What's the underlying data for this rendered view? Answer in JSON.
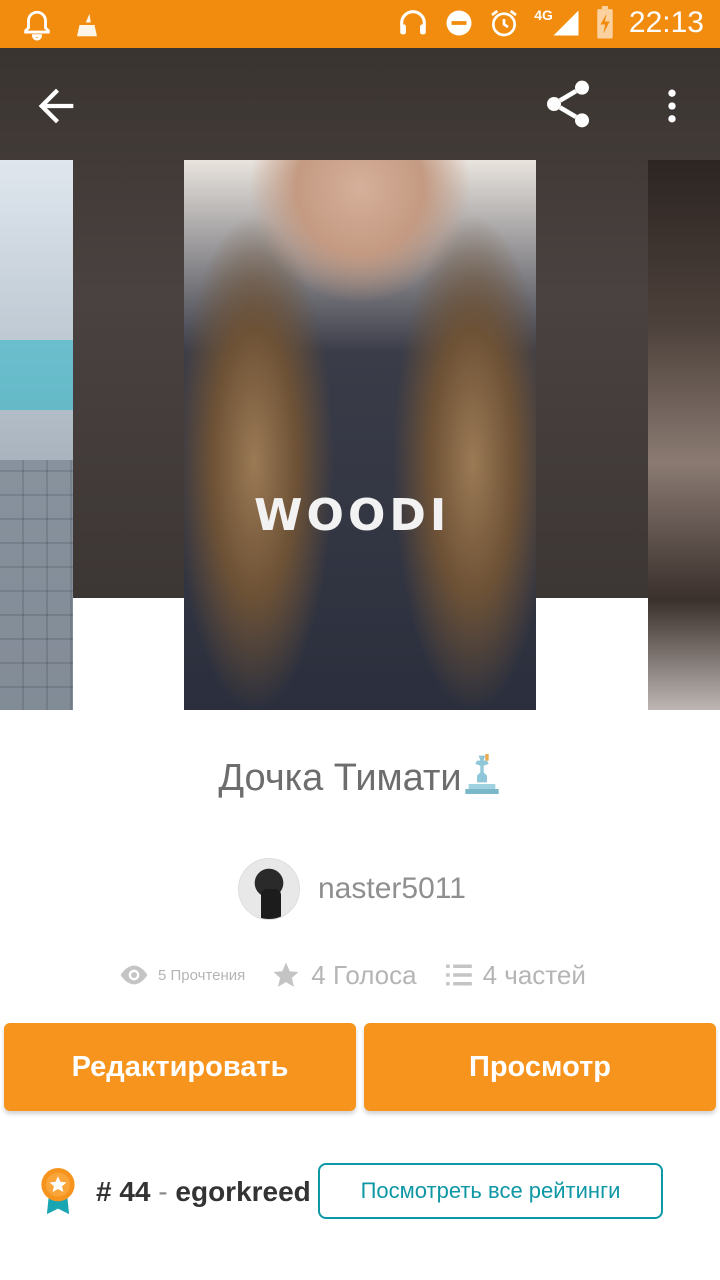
{
  "status_bar": {
    "time": "22:13",
    "network": "4G",
    "icons": [
      "notification-bell-icon",
      "broom-icon",
      "headset-icon",
      "do-not-disturb-icon",
      "alarm-icon",
      "signal-icon",
      "battery-charging-icon"
    ]
  },
  "app_bar": {
    "back_icon": "arrow-left-icon",
    "share_icon": "share-icon",
    "more_icon": "more-vert-icon"
  },
  "story": {
    "title": "Дочка Тимати",
    "shirt_text": "WOODI",
    "author": "naster5011"
  },
  "stats": {
    "reads": "5 Прочтения",
    "votes": "4 Голоса",
    "parts": "4 частей"
  },
  "actions": {
    "edit_label": "Редактировать",
    "view_label": "Просмотр"
  },
  "ranking": {
    "number": "# 44",
    "separator": "-",
    "tag": "egorkreed",
    "all_ratings_label": "Посмотреть все рейтинги"
  },
  "colors": {
    "accent": "#f7941d",
    "status_bar": "#f28c0f",
    "link": "#0e97a5"
  }
}
